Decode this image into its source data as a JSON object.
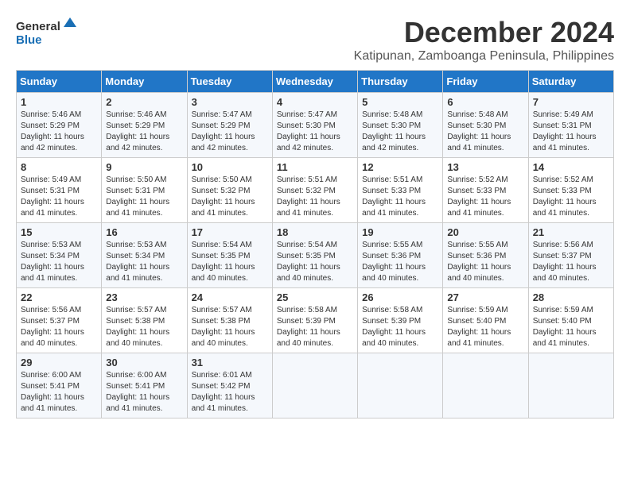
{
  "logo": {
    "line1": "General",
    "line2": "Blue"
  },
  "title": "December 2024",
  "subtitle": "Katipunan, Zamboanga Peninsula, Philippines",
  "days_of_week": [
    "Sunday",
    "Monday",
    "Tuesday",
    "Wednesday",
    "Thursday",
    "Friday",
    "Saturday"
  ],
  "weeks": [
    [
      {
        "day": "1",
        "info": "Sunrise: 5:46 AM\nSunset: 5:29 PM\nDaylight: 11 hours\nand 42 minutes."
      },
      {
        "day": "2",
        "info": "Sunrise: 5:46 AM\nSunset: 5:29 PM\nDaylight: 11 hours\nand 42 minutes."
      },
      {
        "day": "3",
        "info": "Sunrise: 5:47 AM\nSunset: 5:29 PM\nDaylight: 11 hours\nand 42 minutes."
      },
      {
        "day": "4",
        "info": "Sunrise: 5:47 AM\nSunset: 5:30 PM\nDaylight: 11 hours\nand 42 minutes."
      },
      {
        "day": "5",
        "info": "Sunrise: 5:48 AM\nSunset: 5:30 PM\nDaylight: 11 hours\nand 42 minutes."
      },
      {
        "day": "6",
        "info": "Sunrise: 5:48 AM\nSunset: 5:30 PM\nDaylight: 11 hours\nand 41 minutes."
      },
      {
        "day": "7",
        "info": "Sunrise: 5:49 AM\nSunset: 5:31 PM\nDaylight: 11 hours\nand 41 minutes."
      }
    ],
    [
      {
        "day": "8",
        "info": "Sunrise: 5:49 AM\nSunset: 5:31 PM\nDaylight: 11 hours\nand 41 minutes."
      },
      {
        "day": "9",
        "info": "Sunrise: 5:50 AM\nSunset: 5:31 PM\nDaylight: 11 hours\nand 41 minutes."
      },
      {
        "day": "10",
        "info": "Sunrise: 5:50 AM\nSunset: 5:32 PM\nDaylight: 11 hours\nand 41 minutes."
      },
      {
        "day": "11",
        "info": "Sunrise: 5:51 AM\nSunset: 5:32 PM\nDaylight: 11 hours\nand 41 minutes."
      },
      {
        "day": "12",
        "info": "Sunrise: 5:51 AM\nSunset: 5:33 PM\nDaylight: 11 hours\nand 41 minutes."
      },
      {
        "day": "13",
        "info": "Sunrise: 5:52 AM\nSunset: 5:33 PM\nDaylight: 11 hours\nand 41 minutes."
      },
      {
        "day": "14",
        "info": "Sunrise: 5:52 AM\nSunset: 5:33 PM\nDaylight: 11 hours\nand 41 minutes."
      }
    ],
    [
      {
        "day": "15",
        "info": "Sunrise: 5:53 AM\nSunset: 5:34 PM\nDaylight: 11 hours\nand 41 minutes."
      },
      {
        "day": "16",
        "info": "Sunrise: 5:53 AM\nSunset: 5:34 PM\nDaylight: 11 hours\nand 41 minutes."
      },
      {
        "day": "17",
        "info": "Sunrise: 5:54 AM\nSunset: 5:35 PM\nDaylight: 11 hours\nand 40 minutes."
      },
      {
        "day": "18",
        "info": "Sunrise: 5:54 AM\nSunset: 5:35 PM\nDaylight: 11 hours\nand 40 minutes."
      },
      {
        "day": "19",
        "info": "Sunrise: 5:55 AM\nSunset: 5:36 PM\nDaylight: 11 hours\nand 40 minutes."
      },
      {
        "day": "20",
        "info": "Sunrise: 5:55 AM\nSunset: 5:36 PM\nDaylight: 11 hours\nand 40 minutes."
      },
      {
        "day": "21",
        "info": "Sunrise: 5:56 AM\nSunset: 5:37 PM\nDaylight: 11 hours\nand 40 minutes."
      }
    ],
    [
      {
        "day": "22",
        "info": "Sunrise: 5:56 AM\nSunset: 5:37 PM\nDaylight: 11 hours\nand 40 minutes."
      },
      {
        "day": "23",
        "info": "Sunrise: 5:57 AM\nSunset: 5:38 PM\nDaylight: 11 hours\nand 40 minutes."
      },
      {
        "day": "24",
        "info": "Sunrise: 5:57 AM\nSunset: 5:38 PM\nDaylight: 11 hours\nand 40 minutes."
      },
      {
        "day": "25",
        "info": "Sunrise: 5:58 AM\nSunset: 5:39 PM\nDaylight: 11 hours\nand 40 minutes."
      },
      {
        "day": "26",
        "info": "Sunrise: 5:58 AM\nSunset: 5:39 PM\nDaylight: 11 hours\nand 40 minutes."
      },
      {
        "day": "27",
        "info": "Sunrise: 5:59 AM\nSunset: 5:40 PM\nDaylight: 11 hours\nand 41 minutes."
      },
      {
        "day": "28",
        "info": "Sunrise: 5:59 AM\nSunset: 5:40 PM\nDaylight: 11 hours\nand 41 minutes."
      }
    ],
    [
      {
        "day": "29",
        "info": "Sunrise: 6:00 AM\nSunset: 5:41 PM\nDaylight: 11 hours\nand 41 minutes."
      },
      {
        "day": "30",
        "info": "Sunrise: 6:00 AM\nSunset: 5:41 PM\nDaylight: 11 hours\nand 41 minutes."
      },
      {
        "day": "31",
        "info": "Sunrise: 6:01 AM\nSunset: 5:42 PM\nDaylight: 11 hours\nand 41 minutes."
      },
      {
        "day": "",
        "info": ""
      },
      {
        "day": "",
        "info": ""
      },
      {
        "day": "",
        "info": ""
      },
      {
        "day": "",
        "info": ""
      }
    ]
  ]
}
